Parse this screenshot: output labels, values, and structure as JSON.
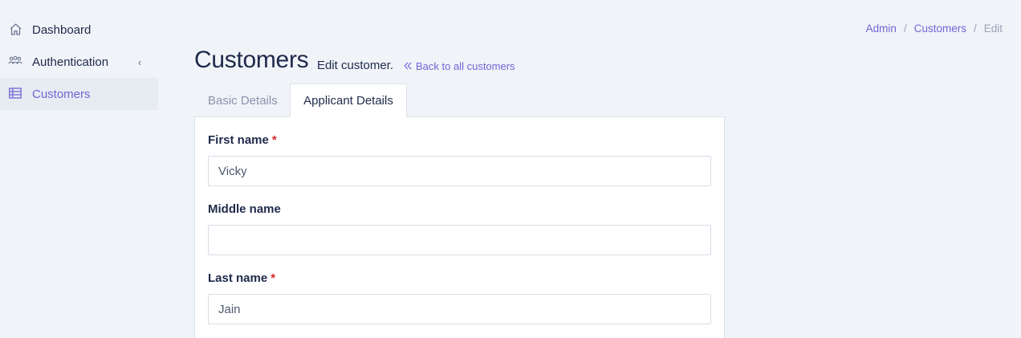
{
  "sidebar": {
    "items": [
      {
        "label": "Dashboard",
        "icon": "home-icon"
      },
      {
        "label": "Authentication",
        "icon": "users-icon",
        "chevron": "‹"
      },
      {
        "label": "Customers",
        "icon": "table-icon"
      }
    ]
  },
  "breadcrumb": {
    "items": [
      "Admin",
      "Customers",
      "Edit"
    ],
    "separator": "/"
  },
  "header": {
    "title": "Customers",
    "subtitle": "Edit customer.",
    "back_link": "Back to all customers"
  },
  "tabs": [
    {
      "label": "Basic Details",
      "active": false
    },
    {
      "label": "Applicant Details",
      "active": true
    }
  ],
  "form": {
    "required_marker": "*",
    "fields": [
      {
        "label": "First name",
        "required": true,
        "value": "Vicky"
      },
      {
        "label": "Middle name",
        "required": false,
        "value": ""
      },
      {
        "label": "Last name",
        "required": true,
        "value": "Jain"
      }
    ]
  },
  "colors": {
    "accent": "#7165d6",
    "background": "#f0f3f8",
    "text": "#1e2a4a",
    "required": "#d62828"
  }
}
